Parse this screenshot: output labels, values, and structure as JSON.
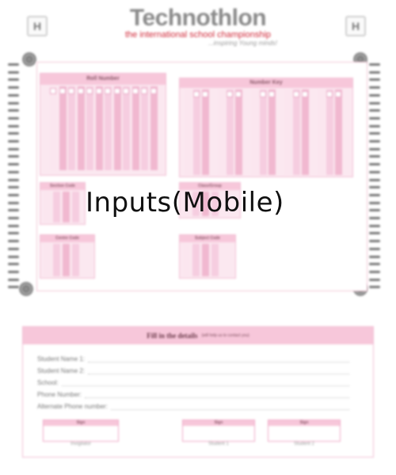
{
  "header": {
    "corner_letter": "H",
    "logo_text": "Technothlon",
    "logo_subtitle": "the international school championship",
    "logo_tagline": "...inspiring Young minds!"
  },
  "omr": {
    "roll_number_title": "Roll Number",
    "number_key_title": "Number Key",
    "mid_left_title": "Section Code",
    "mid_right_title": "Class/Group",
    "low_left_title": "Centre Code",
    "low_right_title": "Subject Code"
  },
  "overlay": {
    "text": "Inputs(Mobile)"
  },
  "details": {
    "title": "Fill in the details",
    "subtitle": "(will help us to contact you)",
    "fields": [
      "Student Name 1:",
      "Student Name 2:",
      "School:",
      "Phone Number:",
      "Alternate Phone number:"
    ],
    "boxes": [
      {
        "head": "Sign",
        "caption": "Invigilator"
      },
      {
        "head": "Sign",
        "caption": "Student 1"
      },
      {
        "head": "Sign",
        "caption": "Student 2"
      }
    ]
  }
}
